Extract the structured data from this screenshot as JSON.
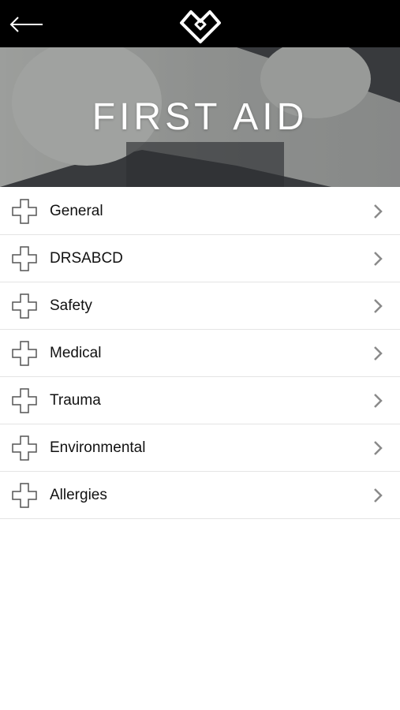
{
  "header": {
    "back_icon": "arrow-left-icon",
    "logo_icon": "heart-diamond-logo"
  },
  "hero": {
    "title": "FIRST AID"
  },
  "list": {
    "item_icon": "cross-outline-icon",
    "chevron_icon": "chevron-right-icon",
    "items": [
      {
        "label": "General"
      },
      {
        "label": "DRSABCD"
      },
      {
        "label": "Safety"
      },
      {
        "label": "Medical"
      },
      {
        "label": "Trauma"
      },
      {
        "label": "Environmental"
      },
      {
        "label": "Allergies"
      }
    ]
  },
  "colors": {
    "topbar": "#000000",
    "background": "#ffffff",
    "text": "#111111",
    "divider": "#e4e4e4",
    "chevron": "#8a8a8a"
  }
}
